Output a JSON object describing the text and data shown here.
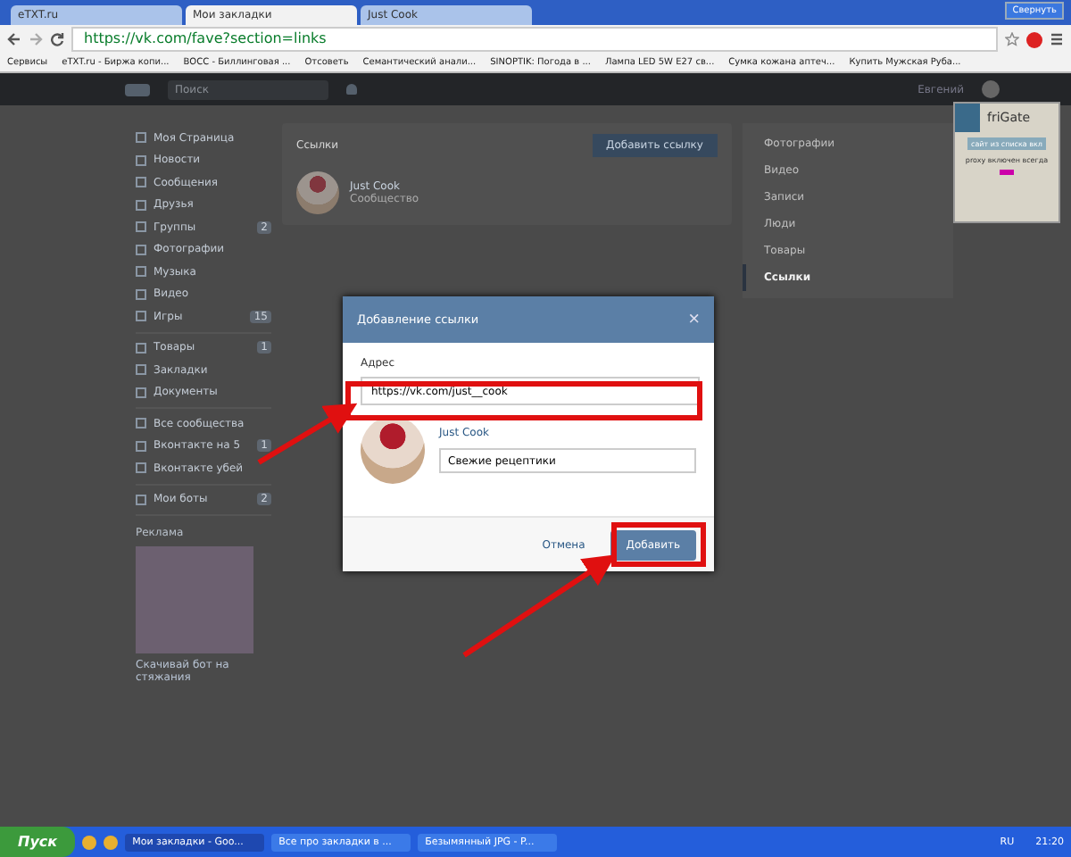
{
  "browser": {
    "tabs": [
      {
        "label": "eTXT.ru",
        "selected": false
      },
      {
        "label": "Мои закладки",
        "selected": true
      },
      {
        "label": "Just Cook",
        "selected": false
      }
    ],
    "window_button": "Свернуть",
    "address": "https://vk.com/fave?section=links",
    "bookmarks": [
      "Сервисы",
      "eTXT.ru - Биржа копи...",
      "ВОСС - Биллинговая ...",
      "Отсоветь",
      "Семантический анали...",
      "SINOPTIK: Погода в ...",
      "Лампа LED 5W E27 св...",
      "Сумка кожана аптеч...",
      "Купить Мужская Руба..."
    ]
  },
  "header": {
    "search_placeholder": "Поиск",
    "user": "Евгений"
  },
  "sidebar": {
    "groups": [
      [
        {
          "label": "Моя Страница"
        },
        {
          "label": "Новости"
        },
        {
          "label": "Сообщения"
        },
        {
          "label": "Друзья"
        },
        {
          "label": "Группы",
          "count": "2"
        },
        {
          "label": "Фотографии"
        },
        {
          "label": "Музыка"
        },
        {
          "label": "Видео"
        },
        {
          "label": "Игры",
          "count": "15"
        }
      ],
      [
        {
          "label": "Товары",
          "count": "1"
        },
        {
          "label": "Закладки"
        },
        {
          "label": "Документы"
        }
      ],
      [
        {
          "label": "Все сообщества"
        },
        {
          "label": "Вконтакте на 5",
          "count": "1"
        },
        {
          "label": "Вконтакте убей"
        }
      ],
      [
        {
          "label": "Мои боты",
          "count": "2"
        }
      ]
    ],
    "ad_title": "Реклама",
    "ad_caption": "Скачивай бот на стяжания"
  },
  "main": {
    "title": "Ссылки",
    "add_button": "Добавить ссылку",
    "links": [
      {
        "name": "Just Cook",
        "subtitle": "Сообщество"
      }
    ]
  },
  "right_menu": [
    {
      "label": "Фотографии",
      "selected": false
    },
    {
      "label": "Видео",
      "selected": false
    },
    {
      "label": "Записи",
      "selected": false
    },
    {
      "label": "Люди",
      "selected": false
    },
    {
      "label": "Товары",
      "selected": false
    },
    {
      "label": "Ссылки",
      "selected": true
    }
  ],
  "frigate": {
    "title": "friGate",
    "status": "сайт из списка вкл",
    "note": "proxy включен всегда"
  },
  "modal": {
    "title": "Добавление ссылки",
    "close": "×",
    "address_label": "Адрес",
    "address_value": "https://vk.com/just__cook",
    "name": "Just Cook",
    "description_value": "Свежие рецептики",
    "cancel": "Отмена",
    "submit": "Добавить"
  },
  "taskbar": {
    "start": "Пуск",
    "windows": [
      {
        "label": "Мои закладки - Goo...",
        "selected": true
      },
      {
        "label": "Все про закладки в ...",
        "selected": false
      },
      {
        "label": "Безымянный JPG - P...",
        "selected": false
      }
    ],
    "lang": "RU",
    "time": "21:20"
  }
}
